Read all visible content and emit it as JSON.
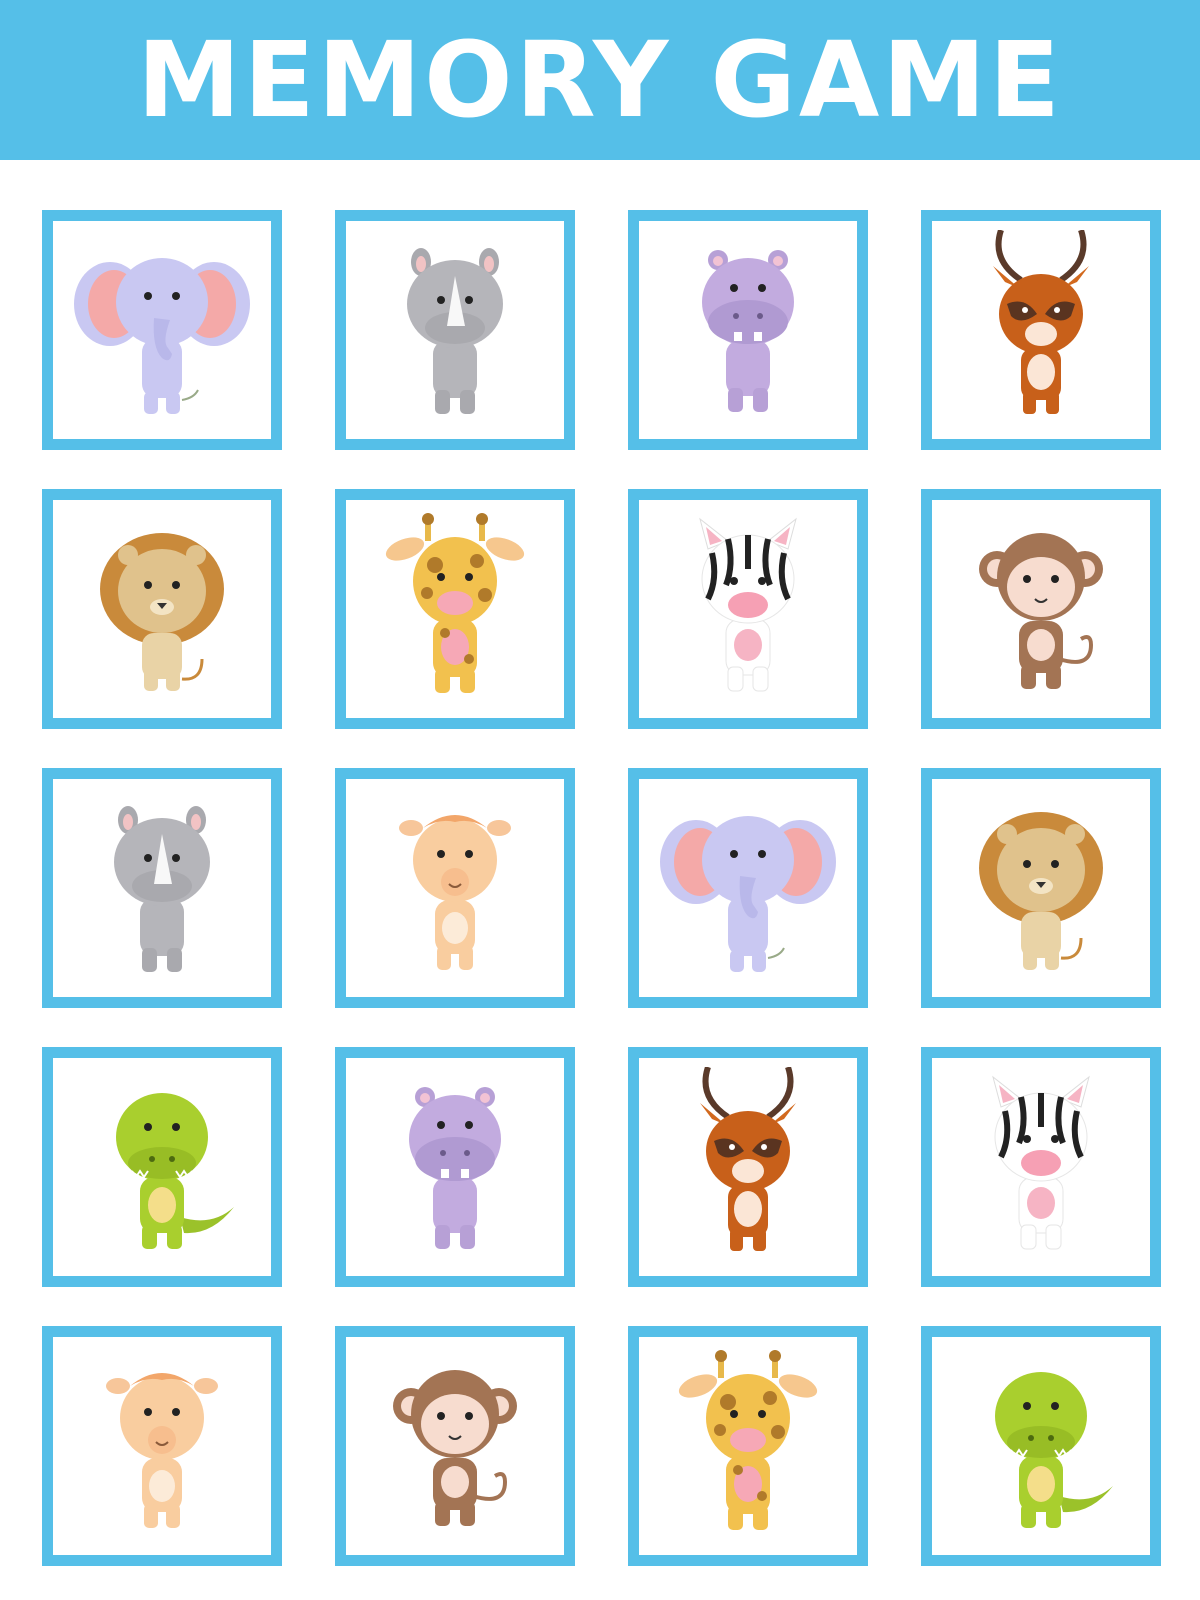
{
  "header": {
    "title": "MEMORY GAME",
    "background_color": "#55BFE8"
  },
  "card_border_color": "#55BFE8",
  "grid": {
    "columns": 4,
    "rows": 5,
    "cards": [
      {
        "animal": "elephant"
      },
      {
        "animal": "rhino"
      },
      {
        "animal": "hippo"
      },
      {
        "animal": "antelope"
      },
      {
        "animal": "lion"
      },
      {
        "animal": "giraffe"
      },
      {
        "animal": "zebra"
      },
      {
        "animal": "monkey"
      },
      {
        "animal": "rhino"
      },
      {
        "animal": "camel"
      },
      {
        "animal": "elephant"
      },
      {
        "animal": "lion"
      },
      {
        "animal": "crocodile"
      },
      {
        "animal": "hippo"
      },
      {
        "animal": "antelope"
      },
      {
        "animal": "zebra"
      },
      {
        "animal": "camel"
      },
      {
        "animal": "monkey"
      },
      {
        "animal": "giraffe"
      },
      {
        "animal": "crocodile"
      }
    ]
  }
}
